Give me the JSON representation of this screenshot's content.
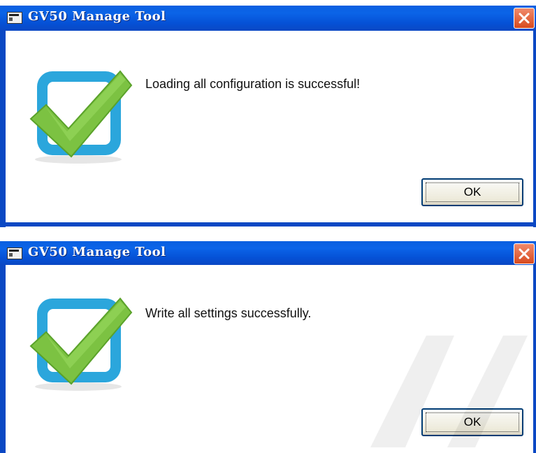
{
  "dialogs": [
    {
      "title": "GV50 Manage Tool",
      "message": "Loading all configuration is successful!",
      "ok_label": "OK"
    },
    {
      "title": "GV50 Manage Tool",
      "message": "Write all settings successfully.",
      "ok_label": "OK"
    }
  ],
  "colors": {
    "titlebar": "#0a5fe0",
    "close_button": "#d84a1e",
    "check_green": "#7cc242",
    "box_blue": "#27a3d8"
  },
  "icons": [
    "app-icon",
    "close-icon",
    "success-check-icon"
  ]
}
